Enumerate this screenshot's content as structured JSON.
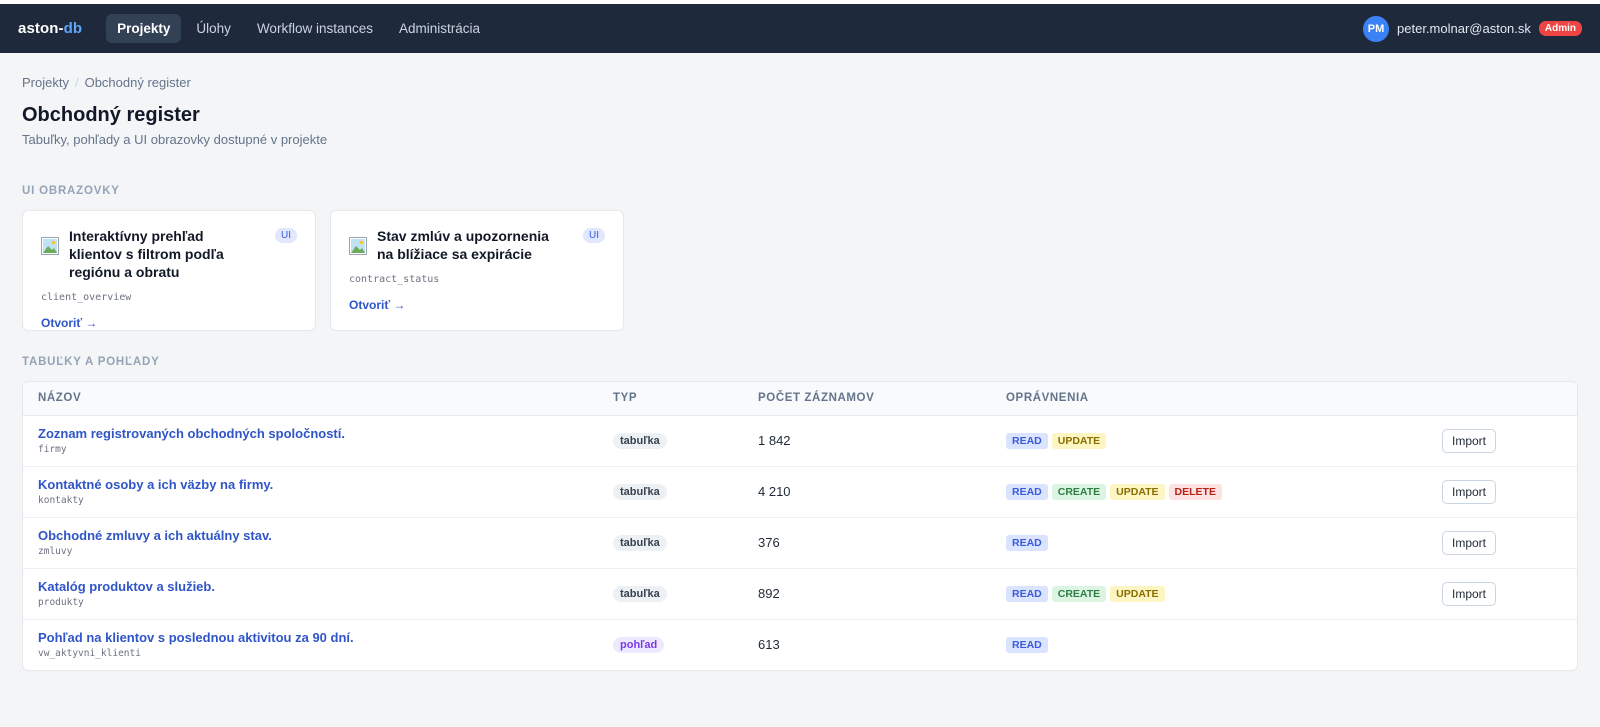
{
  "header": {
    "logo_part1": "aston-",
    "logo_part2": "db",
    "nav": [
      {
        "label": "Projekty",
        "active": true
      },
      {
        "label": "Úlohy",
        "active": false
      },
      {
        "label": "Workflow instances",
        "active": false
      },
      {
        "label": "Administrácia",
        "active": false
      }
    ],
    "user": {
      "initials": "PM",
      "email": "peter.molnar@aston.sk",
      "role": "Admin"
    }
  },
  "breadcrumb": {
    "parent": "Projekty",
    "separator": "/",
    "current": "Obchodný register"
  },
  "page": {
    "title": "Obchodný register",
    "subtitle": "Tabuľky, pohľady a UI obrazovky dostupné v projekte"
  },
  "ui_screens": {
    "label": "UI OBRAZOVKY",
    "cards": [
      {
        "title": "Interaktívny prehľad klientov s filtrom podľa regiónu a obratu",
        "badge": "UI",
        "code": "client_overview",
        "link": "Otvoriť →",
        "icon": "image-icon"
      },
      {
        "title": "Stav zmlúv a upozornenia na blížiace sa expirácie",
        "badge": "UI",
        "code": "contract_status",
        "link": "Otvoriť →",
        "icon": "image-icon"
      }
    ]
  },
  "tables": {
    "label": "TABUĽKY A POHĽADY",
    "columns": {
      "name": "NÁZOV",
      "type": "TYP",
      "count": "POČET ZÁZNAMOV",
      "perms": "OPRÁVNENIA"
    },
    "rows": [
      {
        "title": "Zoznam registrovaných obchodných spoločností.",
        "code": "firmy",
        "type": "tabuľka",
        "count": "1 842",
        "perms": [
          "READ",
          "UPDATE"
        ],
        "action": "Import"
      },
      {
        "title": "Kontaktné osoby a ich väzby na firmy.",
        "code": "kontakty",
        "type": "tabuľka",
        "count": "4 210",
        "perms": [
          "READ",
          "CREATE",
          "UPDATE",
          "DELETE"
        ],
        "action": "Import"
      },
      {
        "title": "Obchodné zmluvy a ich aktuálny stav.",
        "code": "zmluvy",
        "type": "tabuľka",
        "count": "376",
        "perms": [
          "READ"
        ],
        "action": "Import"
      },
      {
        "title": "Katalóg produktov a služieb.",
        "code": "produkty",
        "type": "tabuľka",
        "count": "892",
        "perms": [
          "READ",
          "CREATE",
          "UPDATE"
        ],
        "action": "Import"
      },
      {
        "title": "Pohľad na klientov s poslednou aktivitou za 90 dní.",
        "code": "vw_aktyvni_klienti",
        "type": "pohľad",
        "count": "613",
        "perms": [
          "READ"
        ],
        "action": ""
      }
    ]
  },
  "colors": {
    "topbar": "#1e293b",
    "accent": "#2f55c8",
    "admin_badge": "#ef4444"
  }
}
